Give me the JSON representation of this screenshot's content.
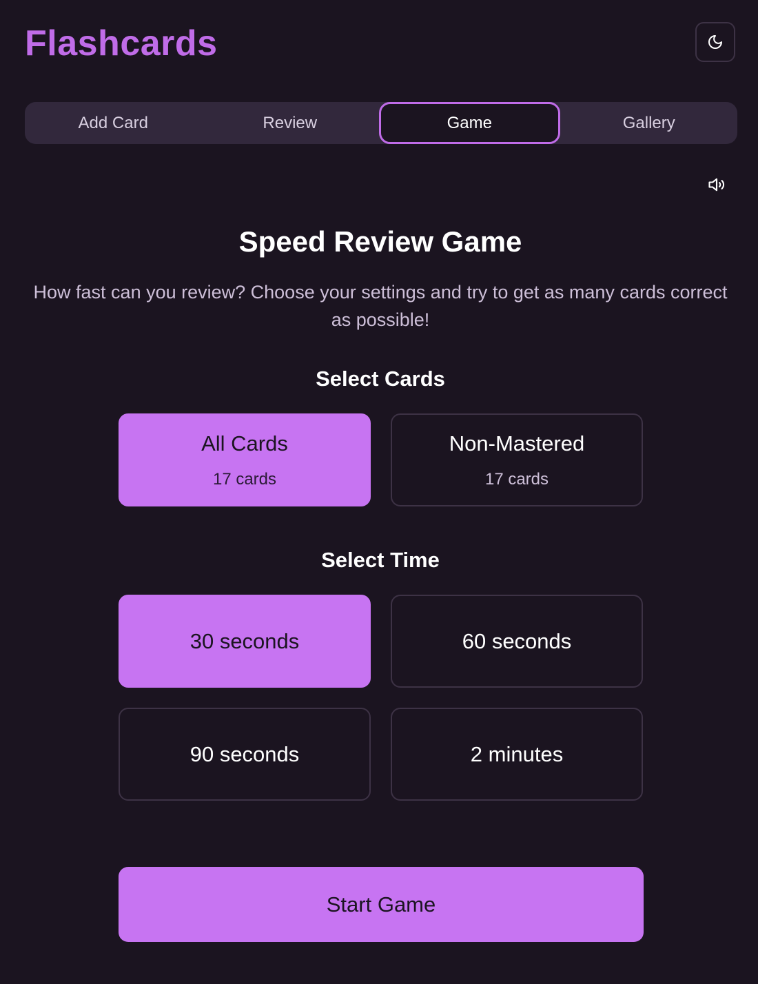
{
  "app": {
    "title": "Flashcards"
  },
  "icons": {
    "theme_toggle": "moon-icon",
    "sound": "speaker-icon"
  },
  "tabs": [
    {
      "label": "Add Card",
      "active": false
    },
    {
      "label": "Review",
      "active": false
    },
    {
      "label": "Game",
      "active": true
    },
    {
      "label": "Gallery",
      "active": false
    }
  ],
  "game": {
    "title": "Speed Review Game",
    "description": "How fast can you review? Choose your settings and try to get as many cards correct as possible!",
    "select_cards": {
      "heading": "Select Cards",
      "options": [
        {
          "label": "All Cards",
          "count": "17 cards",
          "selected": true
        },
        {
          "label": "Non-Mastered",
          "count": "17 cards",
          "selected": false
        }
      ]
    },
    "select_time": {
      "heading": "Select Time",
      "options": [
        {
          "label": "30 seconds",
          "selected": true
        },
        {
          "label": "60 seconds",
          "selected": false
        },
        {
          "label": "90 seconds",
          "selected": false
        },
        {
          "label": "2 minutes",
          "selected": false
        }
      ]
    },
    "start_label": "Start Game"
  },
  "colors": {
    "background": "#1b1420",
    "accent": "#c774f2",
    "title": "#c06ce8",
    "tab_bar": "#32283c"
  }
}
